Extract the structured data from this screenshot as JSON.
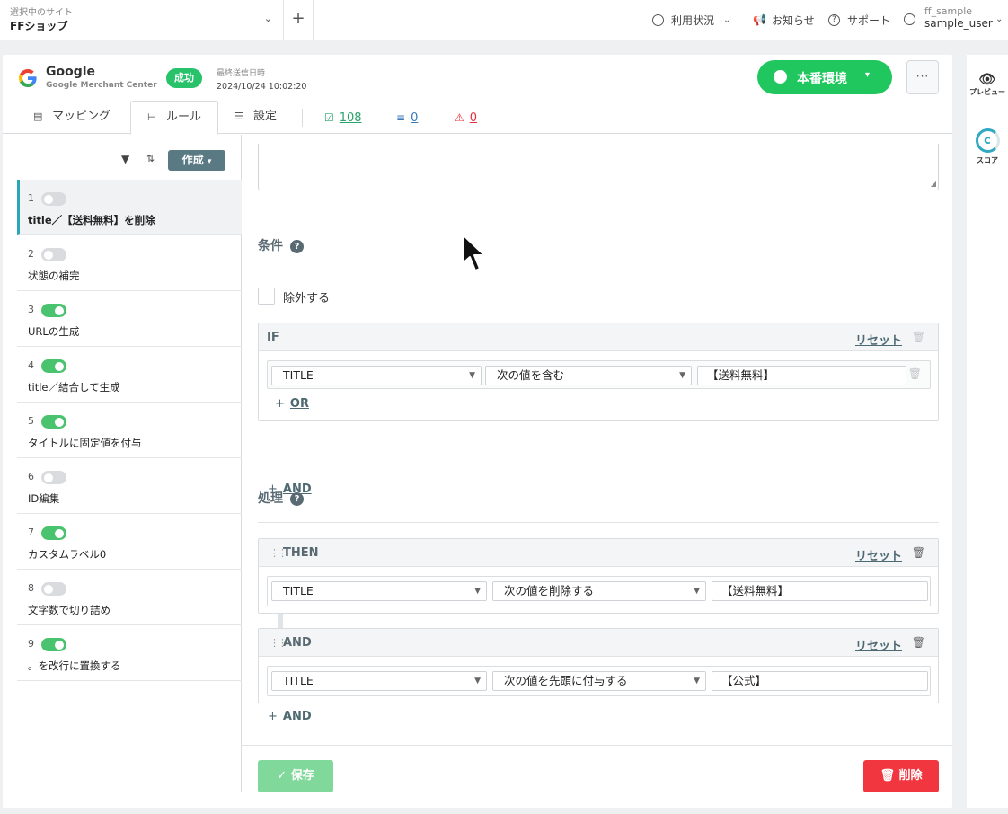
{
  "topbar": {
    "site_caption": "選択中のサイト",
    "site_name": "FFショップ",
    "nav": [
      {
        "label": "利用状況",
        "icon": "gauge-icon"
      },
      {
        "label": "お知らせ",
        "icon": "megaphone-icon"
      },
      {
        "label": "サポート",
        "icon": "help-circle-icon"
      }
    ],
    "user_account": "ff_sample",
    "user_name": "sample_user"
  },
  "channel": {
    "title": "Google",
    "subtitle": "Google Merchant Center",
    "status": "成功",
    "last_sent_label": "最終送信日時",
    "last_sent_value": "2024/10/24 10:02:20",
    "env_label": "本番環境",
    "more_label": "···"
  },
  "tabs": [
    {
      "label": "マッピング",
      "icon": "mapping-icon"
    },
    {
      "label": "ルール",
      "icon": "rules-icon",
      "active": true
    },
    {
      "label": "設定",
      "icon": "sliders-icon"
    }
  ],
  "counters": {
    "ok": "108",
    "excluded": "0",
    "warnings": "0",
    "colors": {
      "ok": "#2aa36b",
      "excluded": "#3c79b8",
      "warnings": "#e0323c"
    }
  },
  "rules_toolbar": {
    "create_label": "作成"
  },
  "rules": [
    {
      "num": "1",
      "label": "title／【送料無料】を削除",
      "enabled": false,
      "active": true
    },
    {
      "num": "2",
      "label": "状態の補完",
      "enabled": false
    },
    {
      "num": "3",
      "label": "URLの生成",
      "enabled": true
    },
    {
      "num": "4",
      "label": "title／結合して生成",
      "enabled": true
    },
    {
      "num": "5",
      "label": "タイトルに固定値を付与",
      "enabled": true
    },
    {
      "num": "6",
      "label": "ID編集",
      "enabled": false
    },
    {
      "num": "7",
      "label": "カスタムラベル0",
      "enabled": true
    },
    {
      "num": "8",
      "label": "文字数で切り詰め",
      "enabled": false
    },
    {
      "num": "9",
      "label": "。を改行に置換する",
      "enabled": true
    }
  ],
  "condition_section": {
    "title": "条件",
    "exclude_label": "除外する",
    "if_label": "IF",
    "reset_label": "リセット",
    "row": {
      "field": "TITLE",
      "operator": "次の値を含む",
      "value": "【送料無料】"
    },
    "or_label": "OR",
    "and_label": "AND"
  },
  "action_section": {
    "title": "処理",
    "then_label": "THEN",
    "and_block_label": "AND",
    "reset_label": "リセット",
    "then_row": {
      "field": "TITLE",
      "operator": "次の値を削除する",
      "value": "【送料無料】"
    },
    "and_row": {
      "field": "TITLE",
      "operator": "次の値を先頭に付与する",
      "value": "【公式】"
    },
    "and_label": "AND"
  },
  "footer": {
    "save_label": "保存",
    "delete_label": "削除"
  },
  "side_panel": {
    "preview_label": "プレビュー",
    "score_label": "スコア"
  }
}
